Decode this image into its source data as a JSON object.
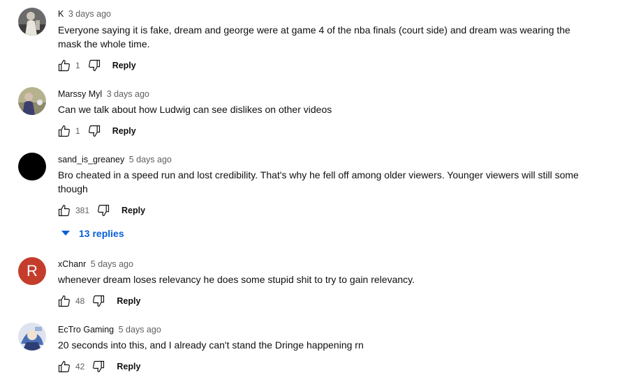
{
  "comments": [
    {
      "author": "K",
      "time": "3 days ago",
      "text": "Everyone saying it is fake, dream and george were at game 4 of the nba finals (court side) and dream was wearing the mask the whole time.",
      "likes": "1",
      "reply_label": "Reply",
      "avatar": "photo-person"
    },
    {
      "author": "Marssy Myl",
      "time": "3 days ago",
      "text": "Can we talk about how Ludwig can see dislikes on other videos",
      "likes": "1",
      "reply_label": "Reply",
      "avatar": "photo-person"
    },
    {
      "author": "sand_is_greaney",
      "time": "5 days ago",
      "text": "Bro cheated in a speed run and lost credibility. That's why he fell off among older viewers. Younger viewers will still some though",
      "likes": "381",
      "reply_label": "Reply",
      "avatar": "black-circle",
      "replies_label": "13 replies"
    },
    {
      "author": "xChanr",
      "time": "5 days ago",
      "text": "whenever dream loses relevancy he does some stupid shit to try to gain relevancy.",
      "likes": "48",
      "reply_label": "Reply",
      "avatar": "letter",
      "avatar_letter": "R",
      "avatar_color": "#c43d2b"
    },
    {
      "author": "EcTro Gaming",
      "time": "5 days ago",
      "text": "20 seconds into this, and I already can't stand the Dringe happening rn",
      "likes": "42",
      "reply_label": "Reply",
      "avatar": "photo-art"
    }
  ],
  "icons": {
    "like": "thumbs-up-icon",
    "dislike": "thumbs-down-icon",
    "replies": "caret-down-icon"
  },
  "colors": {
    "link_blue": "#065fd4",
    "secondary_text": "#606060"
  }
}
